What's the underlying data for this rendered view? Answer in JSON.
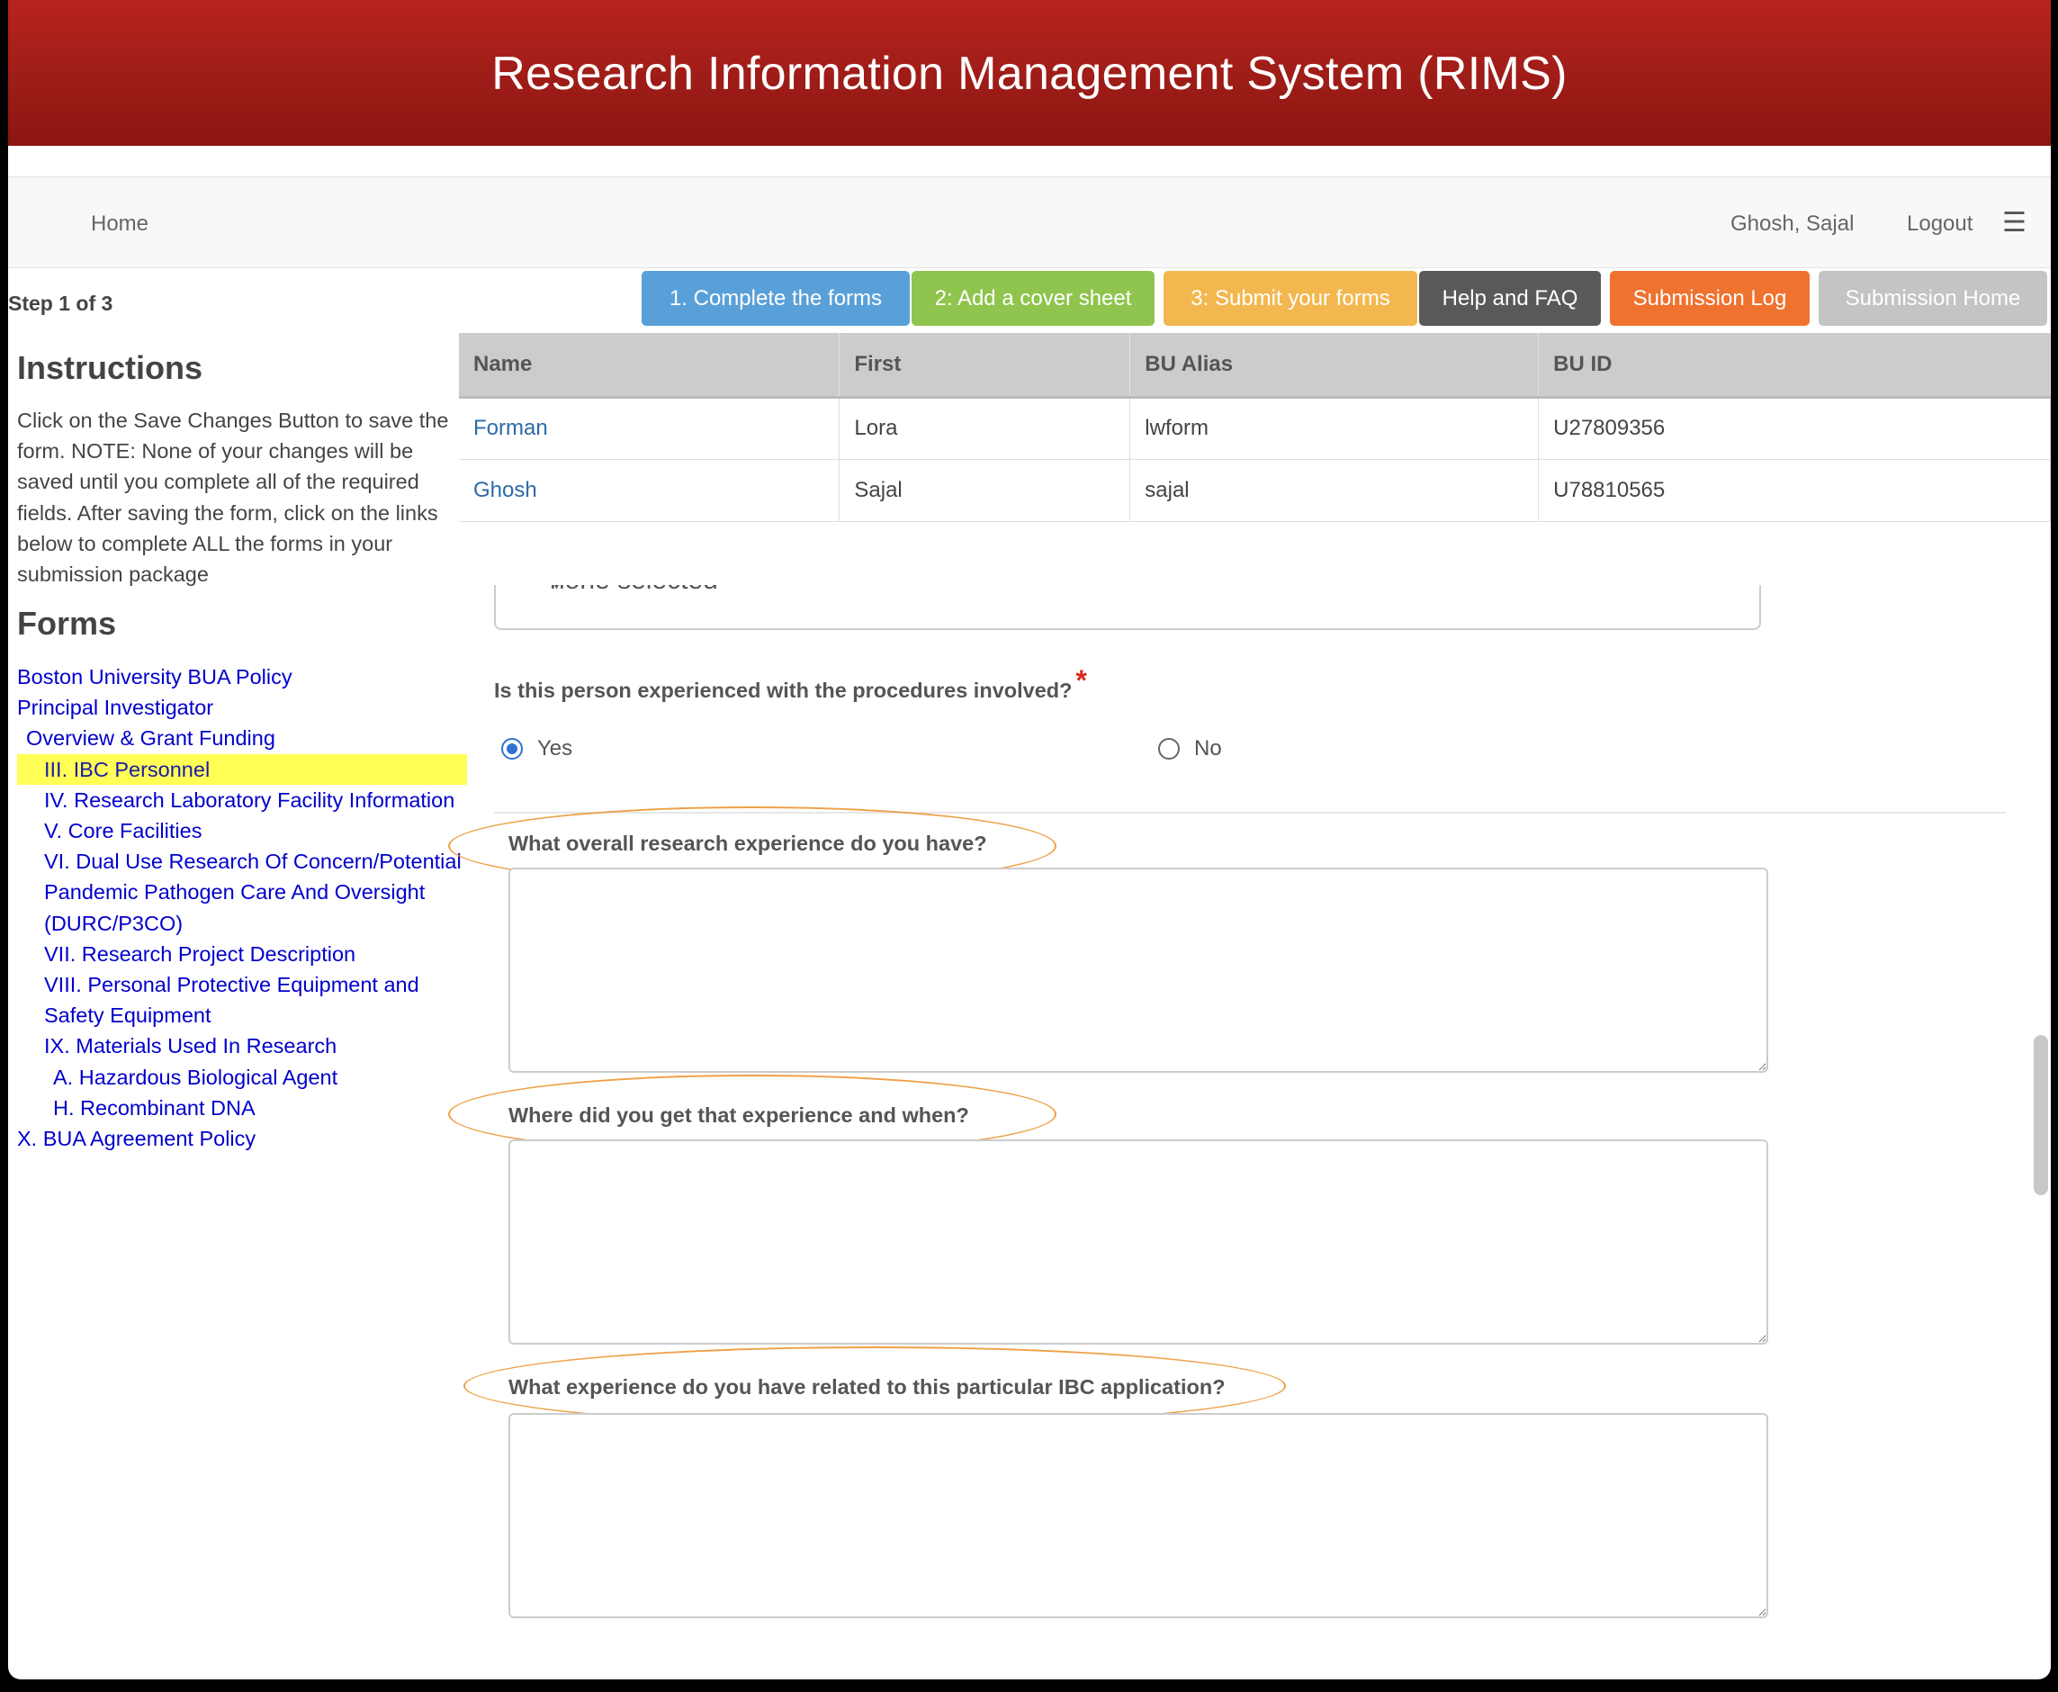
{
  "header": {
    "title": "Research Information Management System (RIMS)"
  },
  "nav": {
    "home": "Home",
    "user": "Ghosh, Sajal",
    "logout": "Logout",
    "menu_icon": "hamburger-menu-icon"
  },
  "step": "Step 1 of 3",
  "buttons": [
    {
      "label": "1. Complete the forms",
      "color": "#5aa0d8"
    },
    {
      "label": "2: Add a cover sheet",
      "color": "#8fc44e"
    },
    {
      "label": "3: Submit your forms",
      "color": "#f2b84f"
    },
    {
      "label": "Help and FAQ",
      "color": "#595959"
    },
    {
      "label": "Submission Log",
      "color": "#ef722f"
    },
    {
      "label": "Submission Home",
      "color": "#c4c4c4"
    }
  ],
  "instructions": {
    "title": "Instructions",
    "text": "Click on the Save Changes Button to save the form. NOTE: None of your changes will be saved until you complete all of the required fields. After saving the form, click on the links below to complete ALL the forms in your submission package"
  },
  "forms": {
    "title": "Forms",
    "items": [
      {
        "label": "Boston University BUA Policy"
      },
      {
        "label": "Principal Investigator"
      },
      {
        "label": "Overview & Grant Funding"
      },
      {
        "label": "III. IBC Personnel"
      },
      {
        "label": "IV. Research Laboratory Facility Information"
      },
      {
        "label": "V. Core Facilities"
      },
      {
        "label": "VI. Dual Use Research Of Concern/Potential Pandemic Pathogen Care And Oversight (DURC/P3CO)"
      },
      {
        "label": "VII. Research Project Description"
      },
      {
        "label": "VIII. Personal Protective Equipment and Safety Equipment"
      },
      {
        "label": "IX. Materials Used In Research"
      },
      {
        "label": "A. Hazardous Biological Agent"
      },
      {
        "label": "H. Recombinant DNA"
      },
      {
        "label": "X. BUA Agreement Policy"
      }
    ]
  },
  "personnel_table": {
    "columns": [
      "Name",
      "First",
      "BU Alias",
      "BU ID"
    ],
    "rows": [
      [
        "Forman",
        "Lora",
        "lwform",
        "U27809356"
      ],
      [
        "Ghosh",
        "Sajal",
        "sajal",
        "U78810565"
      ]
    ]
  },
  "form": {
    "select_value": "none selected",
    "procedures_question": "Is this person experienced with the procedures involved?",
    "required_mark": "*",
    "radio_yes": "Yes",
    "radio_no": "No",
    "radio_selected": "Yes",
    "q_overall": "What overall research experience do you have?",
    "q_where": "Where did you get that experience and when?",
    "q_particular": "What experience do you have related to this particular IBC application?",
    "answer_overall": "",
    "answer_where": "",
    "answer_particular": "",
    "highlight_color": "#eea046"
  }
}
